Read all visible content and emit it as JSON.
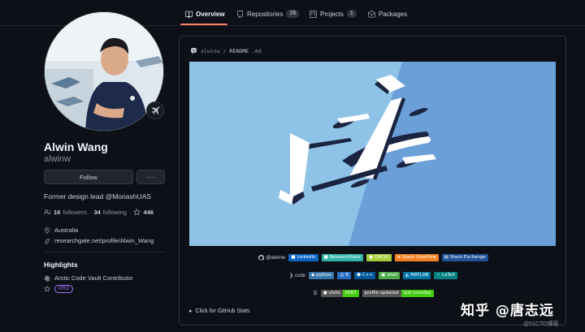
{
  "nav": {
    "tabs": [
      {
        "label": "Overview",
        "icon": "book-icon",
        "active": true
      },
      {
        "label": "Repositories",
        "icon": "repo-icon",
        "count": "26"
      },
      {
        "label": "Projects",
        "icon": "project-icon",
        "count": "1"
      },
      {
        "label": "Packages",
        "icon": "package-icon"
      }
    ]
  },
  "profile": {
    "fullname": "Alwin Wang",
    "username": "alwinw",
    "follow_label": "Follow",
    "more_label": "···",
    "bio": "Former design lead @MonashUAS",
    "followers_count": "16",
    "followers_label": "followers",
    "sep": "·",
    "following_count": "34",
    "following_label": "following",
    "stars_count": "446",
    "location": "Australia",
    "website": "researchgate.net/profile/Alwin_Wang"
  },
  "highlights": {
    "title": "Highlights",
    "items": [
      "Arctic Code Vault Contributor"
    ],
    "pro_label": "PRO"
  },
  "readme": {
    "owner": "alwinw",
    "slash": "/",
    "file": "README",
    "ext": ".md",
    "social_row": {
      "handle": "@alwinw",
      "badges": [
        {
          "label": "LinkedIn",
          "color": "#0a66c2"
        },
        {
          "label": "ResearchGate",
          "color": "#30b5a7"
        },
        {
          "label": "ORCID",
          "color": "#a6ce39"
        },
        {
          "label": "Stack Overflow",
          "color": "#f48024"
        },
        {
          "label": "Stack Exchange",
          "color": "#1e5397"
        }
      ]
    },
    "code_row": {
      "label": "code",
      "badges": [
        {
          "label": "python",
          "color": "#3776ab"
        },
        {
          "label": "R",
          "color": "#276dc3"
        },
        {
          "label": "C++",
          "color": "#00599c"
        },
        {
          "label": "shell",
          "color": "#4ea94b"
        },
        {
          "label": "MATLAB",
          "color": "#0076a8"
        },
        {
          "label": "LaTeX",
          "color": "#008080"
        }
      ]
    },
    "stats_row": {
      "visits_label": "visits",
      "visits_value": "5067",
      "visits_color": "#4c1",
      "updated_label": "profile updated",
      "updated_value": "last monday",
      "updated_color": "#4c1"
    },
    "details_label": "Click for GitHub Stats"
  },
  "watermark": {
    "main": "知乎 @唐志远",
    "small": "@51CTO博客"
  },
  "colors": {
    "background": "#0d1117",
    "accent_underline": "#f78166",
    "sky_light": "#8ec2e6",
    "sky_dark": "#6a9fd8"
  }
}
